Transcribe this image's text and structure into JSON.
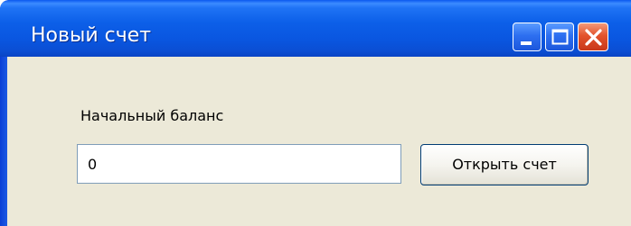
{
  "window": {
    "title": "Новый счет",
    "controls": {
      "minimize_icon": "minimize-icon",
      "maximize_icon": "maximize-icon",
      "close_icon": "close-icon"
    }
  },
  "form": {
    "balance_label": "Начальный баланс",
    "balance_value": "0",
    "open_button_label": "Открыть счет"
  },
  "colors": {
    "titlebar": "#0a56e0",
    "client_background": "#ece9d8",
    "close_button": "#e3532c",
    "input_border": "#7f9db9",
    "button_border": "#003c74"
  }
}
